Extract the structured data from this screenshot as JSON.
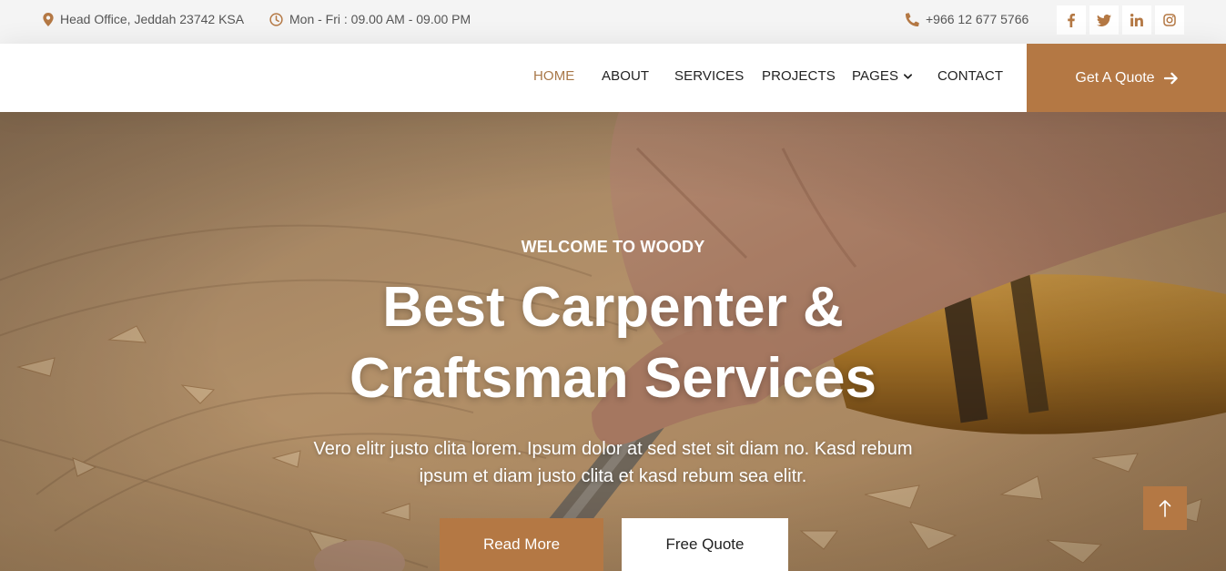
{
  "colors": {
    "accent": "#b47844",
    "active_nav": "#a87849",
    "topbar_bg": "#f4f4f4"
  },
  "topbar": {
    "location": {
      "icon": "map-marker-icon",
      "text": "Head Office, Jeddah 23742 KSA"
    },
    "hours": {
      "icon": "clock-icon",
      "text": "Mon - Fri : 09.00 AM - 09.00 PM"
    },
    "phone": {
      "icon": "phone-icon",
      "text": "+966 12 677 5766"
    },
    "socials": [
      "facebook-icon",
      "twitter-icon",
      "linkedin-icon",
      "instagram-icon"
    ]
  },
  "nav": {
    "items": [
      {
        "label": "HOME",
        "active": true
      },
      {
        "label": "ABOUT"
      },
      {
        "label": "SERVICES"
      },
      {
        "label": "PROJECTS"
      },
      {
        "label": "PAGES",
        "dropdown": true
      },
      {
        "label": "CONTACT"
      }
    ],
    "cta": "Get A Quote"
  },
  "hero": {
    "subtitle": "WELCOME TO WOODY",
    "title_line1": "Best Carpenter &",
    "title_line2": "Craftsman Services",
    "text_line1": "Vero elitr justo clita lorem. Ipsum dolor at sed stet sit diam no. Kasd rebum",
    "text_line2": "ipsum et diam justo clita et kasd rebum sea elitr.",
    "primary_button": "Read More",
    "secondary_button": "Free Quote"
  }
}
